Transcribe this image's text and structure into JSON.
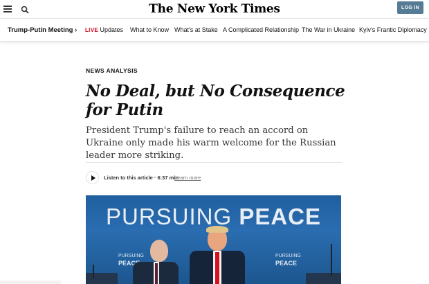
{
  "header": {
    "logo": "The New York Times",
    "login_label": "LOG IN"
  },
  "subnav": {
    "story_title": "Trump-Putin Meeting ›",
    "live_tag": "LIVE",
    "items": [
      "Updates",
      "What to Know",
      "What's at Stake",
      "A Complicated Relationship",
      "The War in Ukraine",
      "Kyiv's Frantic Diplomacy"
    ]
  },
  "article": {
    "kicker": "NEWS ANALYSIS",
    "headline": "No Deal, but No Consequence for Putin",
    "summary": "President Trump's failure to reach an accord on Ukraine only made his warm welcome for the Russian leader more striking.",
    "listen_label": "Listen to this article · 6:37 min",
    "learn_more": "Learn more"
  },
  "photo": {
    "banner_word_1": "PURSUING",
    "banner_word_2": "PEACE",
    "small_logo_line1": "PURSUING",
    "small_logo_line2": "PEACE"
  },
  "colors": {
    "live_red": "#d0021b",
    "login_button": "#567b95",
    "photo_blue": "#1f5fa0"
  },
  "icons": [
    "menu-icon",
    "search-icon",
    "play-icon"
  ]
}
